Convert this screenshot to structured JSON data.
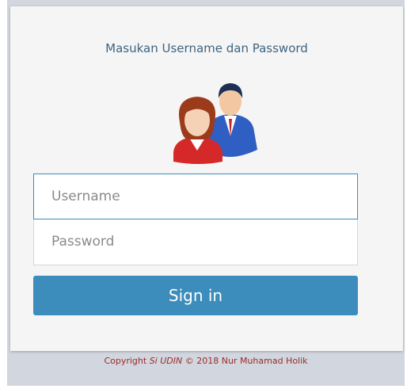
{
  "header": {
    "title": "Masukan Username dan Password"
  },
  "form": {
    "username_placeholder": "Username",
    "password_placeholder": "Password",
    "signin_label": "Sign in"
  },
  "footer": {
    "prefix": "Copyright ",
    "app_name": "Si UDIN",
    "suffix": " © 2018 Nur Muhamad Holik"
  },
  "colors": {
    "accent": "#3c8dbc",
    "title_text": "#3d6480",
    "footer_text": "#9b2b2b",
    "card_bg": "#f5f5f5",
    "page_bg": "#d2d6de"
  },
  "icons": {
    "avatar": "users-icon"
  }
}
